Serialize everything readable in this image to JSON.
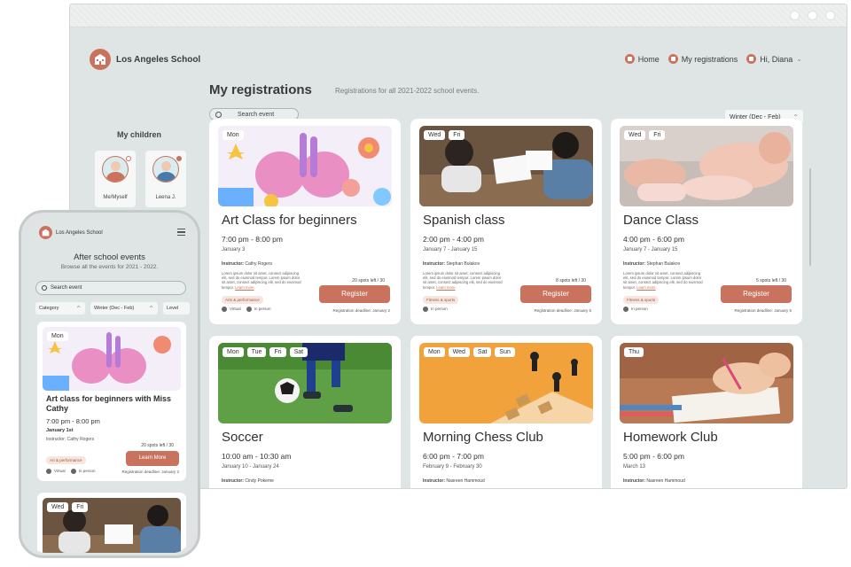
{
  "colors": {
    "accent": "#c9735e",
    "background": "#dfe5e5",
    "card": "#ffffff"
  },
  "brand": {
    "name": "Los Angeles School",
    "logo_icon": "school-building-icon"
  },
  "nav": [
    {
      "label": "Home",
      "icon": "home-icon"
    },
    {
      "label": "My registrations",
      "icon": "calendar-icon"
    },
    {
      "label": "Hi, Diana",
      "icon": "user-icon"
    }
  ],
  "page": {
    "title": "My registrations",
    "subtitle": "Registrations for all 2021-2022 school events.",
    "search_placeholder": "Search event",
    "season_filter": "Winter (Dec - Feb)"
  },
  "children": {
    "title": "My children",
    "items": [
      {
        "name": "Me/Myself"
      },
      {
        "name": "Leena J."
      }
    ]
  },
  "cards": [
    {
      "days": [
        "Mon"
      ],
      "title": "Art Class for beginners",
      "time": "7:00 pm - 8:00 pm",
      "date": "January 3",
      "instructor_label": "Instructor:",
      "instructor": "Cathy Rogers",
      "desc": "Lorem ipsum dolor sit amet, consect adipiscing elit, sed do eiusmod tempor. Lorem ipsum dolor sit amet, consect adipiscing elit, sed do eiusmod tempor.",
      "learn_more": "Learn more",
      "spots": "20 spots left / 30",
      "button": "Register",
      "tag": "Arts & performance",
      "modes": [
        "Virtual",
        "In person"
      ],
      "deadline": "Registration deadline: January 2"
    },
    {
      "days": [
        "Wed",
        "Fri"
      ],
      "title": "Spanish class",
      "time": "2:00 pm - 4:00 pm",
      "date": "January 7 - January 15",
      "instructor_label": "Instructor:",
      "instructor": "Stephan Bulakov",
      "desc": "Lorem ipsum dolor sit amet, consect adipiscing elit, sed do eiusmod tempor. Lorem ipsum dolor sit amet, consect adipiscing elit, sed do eiusmod tempor.",
      "learn_more": "Learn more",
      "spots": "8 spots left / 30",
      "button": "Register",
      "tag": "Fitness & sports",
      "modes": [
        "In person"
      ],
      "deadline": "Registration deadline: January 5"
    },
    {
      "days": [
        "Wed",
        "Fri"
      ],
      "title": "Dance Class",
      "time": "4:00 pm - 6:00 pm",
      "date": "January 7 - January 15",
      "instructor_label": "Instructor:",
      "instructor": "Stephan Bulakov",
      "desc": "Lorem ipsum dolor sit amet, consect adipiscing elit, sed do eiusmod tempor. Lorem ipsum dolor sit amet, consect adipiscing elit, sed do eiusmod tempor.",
      "learn_more": "Learn more",
      "spots": "5 spots left / 30",
      "button": "Register",
      "tag": "Fitness & sports",
      "modes": [
        "In person"
      ],
      "deadline": "Registration deadline: January 5"
    },
    {
      "days": [
        "Mon",
        "Tue",
        "Fri",
        "Sat"
      ],
      "title": "Soccer",
      "time": "10:00 am - 10:30 am",
      "date": "January 10 - January 24",
      "instructor_label": "Instructor:",
      "instructor": "Cindy Pokeme"
    },
    {
      "days": [
        "Mon",
        "Wed",
        "Sat",
        "Sun"
      ],
      "title": "Morning Chess Club",
      "time": "6:00 pm - 7:00 pm",
      "date": "February 9 - February 30",
      "instructor_label": "Instructor:",
      "instructor": "Nasreen Hammoud"
    },
    {
      "days": [
        "Thu"
      ],
      "title": "Homework Club",
      "time": "5:00 pm - 6:00 pm",
      "date": "March 13",
      "instructor_label": "Instructor:",
      "instructor": "Nasreen Hammoud"
    }
  ],
  "phone": {
    "brand": "Los Angeles School",
    "title": "After school events",
    "subtitle": "Browse all the events for 2021 - 2022.",
    "search_placeholder": "Search event",
    "filters": [
      "Category",
      "Winter (Dec - Feb)",
      "Level"
    ],
    "card": {
      "days": [
        "Mon"
      ],
      "title": "Art class for beginners with Miss Cathy",
      "time": "7:00 pm - 8:00 pm",
      "date": "January 1st",
      "instructor": "Instructor: Cathy Rogers",
      "spots": "20 spots left / 30",
      "button": "Learn More",
      "tag": "Art & performance",
      "modes": [
        "Virtual",
        "In person"
      ],
      "deadline": "Registration deadline: January 2"
    },
    "card2": {
      "days": [
        "Wed",
        "Fri"
      ]
    }
  }
}
